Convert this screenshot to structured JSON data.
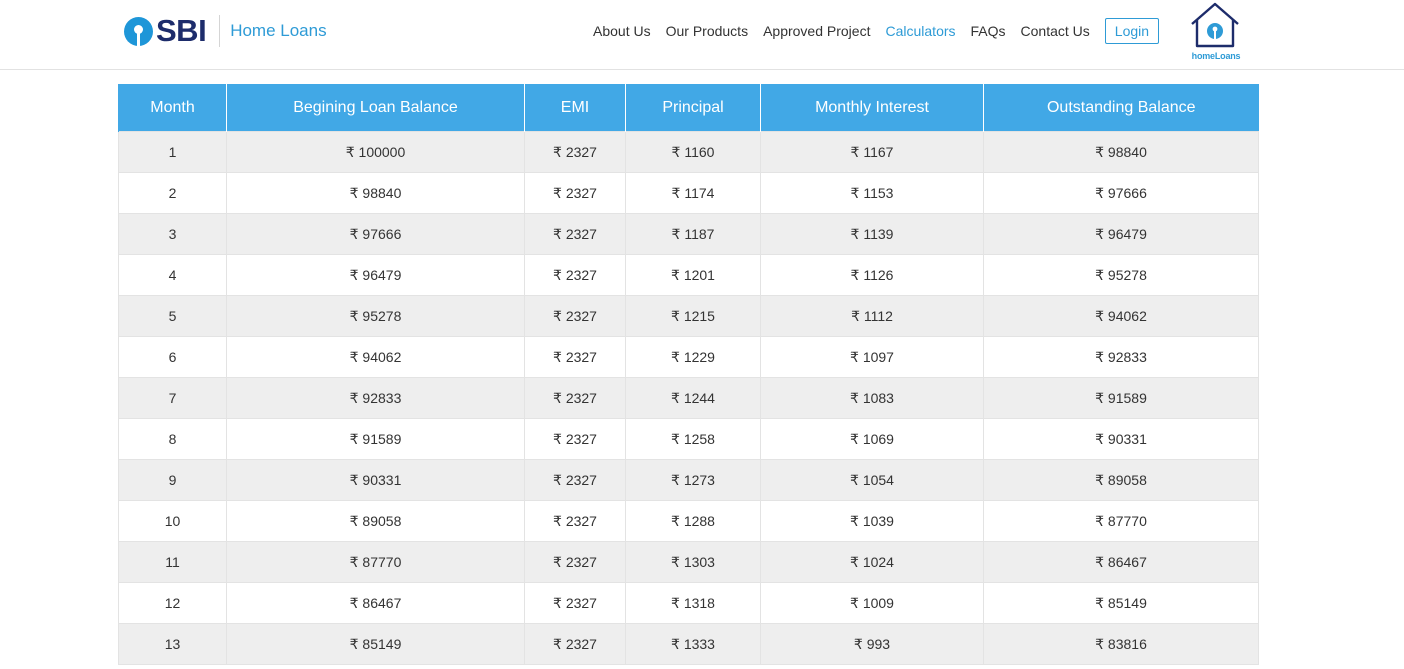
{
  "header": {
    "brand": "SBI",
    "brand_sub": "Home Loans",
    "nav": [
      {
        "label": "About Us",
        "active": false
      },
      {
        "label": "Our Products",
        "active": false
      },
      {
        "label": "Approved Project",
        "active": false
      },
      {
        "label": "Calculators",
        "active": true
      },
      {
        "label": "FAQs",
        "active": false
      },
      {
        "label": "Contact Us",
        "active": false
      }
    ],
    "login_label": "Login",
    "home_logo_text": "homeLoans",
    "accent_color": "#2e9bd6",
    "brand_color": "#1d2c6b"
  },
  "table": {
    "header_color": "#41a8e6",
    "columns": [
      "Month",
      "Begining Loan Balance",
      "EMI",
      "Principal",
      "Monthly Interest",
      "Outstanding Balance"
    ],
    "rows": [
      [
        "1",
        "₹ 100000",
        "₹ 2327",
        "₹ 1160",
        "₹ 1167",
        "₹ 98840"
      ],
      [
        "2",
        "₹ 98840",
        "₹ 2327",
        "₹ 1174",
        "₹ 1153",
        "₹ 97666"
      ],
      [
        "3",
        "₹ 97666",
        "₹ 2327",
        "₹ 1187",
        "₹ 1139",
        "₹ 96479"
      ],
      [
        "4",
        "₹ 96479",
        "₹ 2327",
        "₹ 1201",
        "₹ 1126",
        "₹ 95278"
      ],
      [
        "5",
        "₹ 95278",
        "₹ 2327",
        "₹ 1215",
        "₹ 1112",
        "₹ 94062"
      ],
      [
        "6",
        "₹ 94062",
        "₹ 2327",
        "₹ 1229",
        "₹ 1097",
        "₹ 92833"
      ],
      [
        "7",
        "₹ 92833",
        "₹ 2327",
        "₹ 1244",
        "₹ 1083",
        "₹ 91589"
      ],
      [
        "8",
        "₹ 91589",
        "₹ 2327",
        "₹ 1258",
        "₹ 1069",
        "₹ 90331"
      ],
      [
        "9",
        "₹ 90331",
        "₹ 2327",
        "₹ 1273",
        "₹ 1054",
        "₹ 89058"
      ],
      [
        "10",
        "₹ 89058",
        "₹ 2327",
        "₹ 1288",
        "₹ 1039",
        "₹ 87770"
      ],
      [
        "11",
        "₹ 87770",
        "₹ 2327",
        "₹ 1303",
        "₹ 1024",
        "₹ 86467"
      ],
      [
        "12",
        "₹ 86467",
        "₹ 2327",
        "₹ 1318",
        "₹ 1009",
        "₹ 85149"
      ],
      [
        "13",
        "₹ 85149",
        "₹ 2327",
        "₹ 1333",
        "₹ 993",
        "₹ 83816"
      ]
    ]
  }
}
